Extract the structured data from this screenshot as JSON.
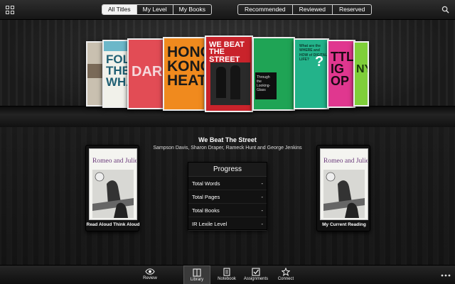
{
  "header": {
    "filter_tabs": [
      {
        "label": "All Titles",
        "active": true
      },
      {
        "label": "My Level",
        "active": false
      },
      {
        "label": "My Books",
        "active": false
      }
    ],
    "list_tabs": [
      {
        "label": "Recommended"
      },
      {
        "label": "Reviewed"
      },
      {
        "label": "Reserved"
      }
    ],
    "menu_icon": "grid-icon",
    "search_icon": "search-icon"
  },
  "carousel": {
    "books": [
      {
        "cover_text": ""
      },
      {
        "cover_text": "FOLL THE WHA"
      },
      {
        "cover_text": "DARE"
      },
      {
        "cover_text": "HONG KONG HEAT"
      },
      {
        "cover_text": "WE BEAT THE STREET"
      },
      {
        "cover_text": "Through the Looking-Glass"
      },
      {
        "cover_text": "What are the WHERE and HOW of DIGITAL LIFE?"
      },
      {
        "cover_text": "TTLE IG OP"
      },
      {
        "cover_text": "NY"
      }
    ],
    "selected": {
      "title": "We Beat The Street",
      "authors": "Sampson Davis, Sharon Draper, Rameck Hunt and George Jenkins"
    }
  },
  "cards": {
    "left": {
      "cover_title": "Romeo and Juliet",
      "label": "Read Aloud Think Aloud"
    },
    "right": {
      "cover_title": "Romeo and Juliet",
      "label": "My Current Reading"
    }
  },
  "progress": {
    "title": "Progress",
    "rows": [
      {
        "label": "Total Words",
        "value": "-"
      },
      {
        "label": "Total Pages",
        "value": "-"
      },
      {
        "label": "Total Books",
        "value": "-"
      },
      {
        "label": "IR Lexile Level",
        "value": "-"
      }
    ]
  },
  "bottom_nav": {
    "items": [
      {
        "label": "Review",
        "icon": "eye-icon",
        "active": false
      },
      {
        "label": "Library",
        "icon": "book-icon",
        "active": true
      },
      {
        "label": "Notebook",
        "icon": "notebook-icon",
        "active": false
      },
      {
        "label": "Assignments",
        "icon": "checkbox-icon",
        "active": false
      },
      {
        "label": "Connect",
        "icon": "star-icon",
        "active": false
      }
    ],
    "more_icon": "more-icon"
  }
}
